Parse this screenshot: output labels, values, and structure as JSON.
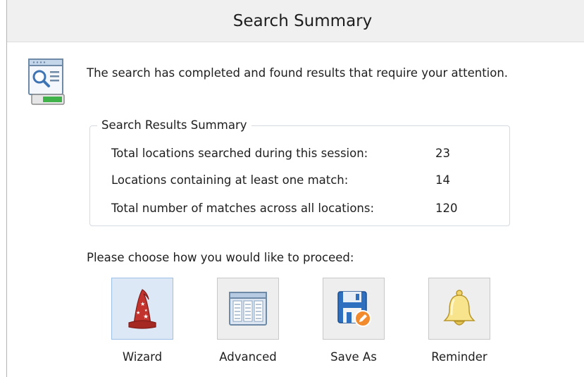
{
  "header": {
    "title": "Search Summary"
  },
  "intro": {
    "text": "The search has completed and found results that require your attention."
  },
  "summary": {
    "legend": "Search Results Summary",
    "rows": [
      {
        "label": "Total locations searched during this session:",
        "value": "23"
      },
      {
        "label": "Locations containing at least one match:",
        "value": "14"
      },
      {
        "label": "Total number of matches across all locations:",
        "value": "120"
      }
    ]
  },
  "prompt": "Please choose how you would like to proceed:",
  "actions": [
    {
      "label": "Wizard",
      "icon": "wizard-hat-icon",
      "selected": true
    },
    {
      "label": "Advanced",
      "icon": "advanced-grid-icon",
      "selected": false
    },
    {
      "label": "Save As",
      "icon": "save-as-floppy-icon",
      "selected": false
    },
    {
      "label": "Reminder",
      "icon": "bell-icon",
      "selected": false
    }
  ],
  "colors": {
    "header_bg": "#f0f0f0",
    "selected_tile_bg": "#dde8f6",
    "tile_bg": "#eeeeee",
    "group_border": "#d4dae0"
  }
}
